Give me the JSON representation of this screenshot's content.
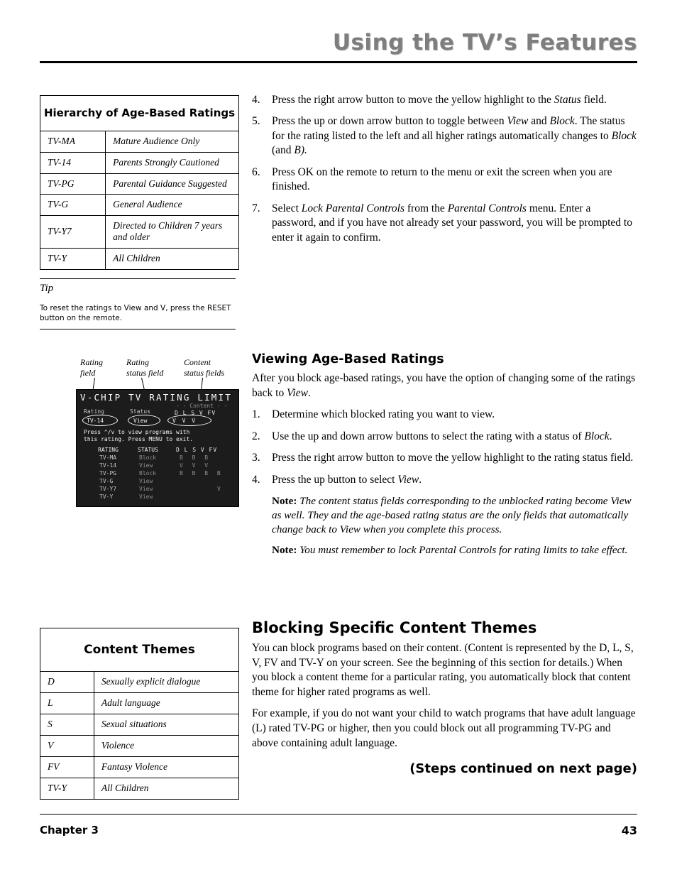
{
  "header": {
    "title": "Using the TV’s Features"
  },
  "hierarchy_table": {
    "title": "Hierarchy of Age-Based Ratings",
    "rows": [
      {
        "code": "TV-MA",
        "desc": "Mature Audience Only"
      },
      {
        "code": "TV-14",
        "desc": "Parents Strongly Cautioned"
      },
      {
        "code": "TV-PG",
        "desc": "Parental Guidance Suggested"
      },
      {
        "code": "TV-G",
        "desc": "General Audience"
      },
      {
        "code": "TV-Y7",
        "desc": "Directed to Children 7 years and older"
      },
      {
        "code": "TV-Y",
        "desc": "All Children"
      }
    ]
  },
  "tip": {
    "label": "Tip",
    "text": "To reset the ratings to View and V, press the RESET button on the remote."
  },
  "figure": {
    "callouts": [
      {
        "line1": "Rating",
        "line2": "field"
      },
      {
        "line1": "Rating",
        "line2": "status field"
      },
      {
        "line1": "Content",
        "line2": "status fields"
      }
    ],
    "screen": {
      "title": "V-CHIP TV RATING LIMIT",
      "content_header": "- - Content - -",
      "col_headers": "D  L  S  V  FV",
      "field_rating_label": "Rating",
      "field_status_label": "Status",
      "selected_rating": "TV-14",
      "selected_status": "View",
      "selected_content": "V   V   V",
      "instructions_line1": "Press ^/v to view programs with",
      "instructions_line2": "this rating. Press MENU to exit.",
      "table_head_rating": "RATING",
      "table_head_status": "STATUS",
      "table_head_content": "D   L   S   V   FV",
      "rows": [
        {
          "rating": "TV-MA",
          "status": "Block",
          "content": "B  B  B"
        },
        {
          "rating": "TV-14",
          "status": "View",
          "content": "V  V  V"
        },
        {
          "rating": "TV-PG",
          "status": "Block",
          "content": "B  B  B  B"
        },
        {
          "rating": "TV-G",
          "status": "View",
          "content": ""
        },
        {
          "rating": "TV-Y7",
          "status": "View",
          "content": "V"
        },
        {
          "rating": "TV-Y",
          "status": "View",
          "content": ""
        }
      ]
    }
  },
  "steps_top": [
    {
      "num": "4.",
      "html": "Press the right arrow button to move the yellow highlight to the <i>Status</i> field."
    },
    {
      "num": "5.",
      "html": "Press the up or down arrow button to toggle between <i>View</i> and <i>Block</i>. The status for the rating listed to the left and all higher ratings automatically changes to <i>Block</i> (and <i>B).</i>"
    },
    {
      "num": "6.",
      "html": "Press OK on the remote to return to the menu or exit the screen when you are finished."
    },
    {
      "num": "7.",
      "html": "Select <i>Lock Parental Controls</i> from the <i>Parental Controls</i> menu. Enter a password, and if you have not already set your password, you will be prompted to enter it again to confirm."
    }
  ],
  "viewing_section": {
    "heading": "Viewing Age-Based Ratings",
    "intro": "After you block age-based ratings, you have the option of changing some of the ratings back to <i>View</i>.",
    "steps": [
      {
        "num": "1.",
        "html": "Determine which blocked rating you want to view."
      },
      {
        "num": "2.",
        "html": "Use the up and down arrow buttons to select the rating with a status of <i>Block</i>."
      },
      {
        "num": "3.",
        "html": "Press the right arrow button to move the yellow highlight to the rating status field."
      },
      {
        "num": "4.",
        "html": "Press the up button to select <i>View</i>."
      }
    ],
    "note1_label": "Note:",
    "note1_text": "The content status fields corresponding to the unblocked rating become View as well. They and the age-based rating status are the only fields that automatically change back to View when you complete this process.",
    "note2_label": "Note:",
    "note2_text": "You must remember to lock Parental Controls for rating limits to take effect."
  },
  "content_themes_table": {
    "title": "Content Themes",
    "rows": [
      {
        "code": "D",
        "desc": "Sexually explicit dialogue"
      },
      {
        "code": "L",
        "desc": "Adult language"
      },
      {
        "code": "S",
        "desc": "Sexual situations"
      },
      {
        "code": "V",
        "desc": "Violence"
      },
      {
        "code": "FV",
        "desc": "Fantasy Violence"
      },
      {
        "code": "TV-Y",
        "desc": "All Children"
      }
    ]
  },
  "blocking_section": {
    "heading": "Blocking Specific Content Themes",
    "para1": "You can block programs based on their content. (Content is represented by the D, L, S, V, FV and TV-Y on your screen. See the beginning of this section for details.) When you block a content theme for a particular rating, you automatically block that content theme for higher rated programs as well.",
    "para2": "For example, if you do not want your child to watch programs that have adult language (L) rated TV-PG or higher, then you could block out all programming TV-PG and above containing adult language."
  },
  "steps_continued": "(Steps continued on next page)",
  "footer": {
    "chapter": "Chapter 3",
    "page": "43"
  }
}
